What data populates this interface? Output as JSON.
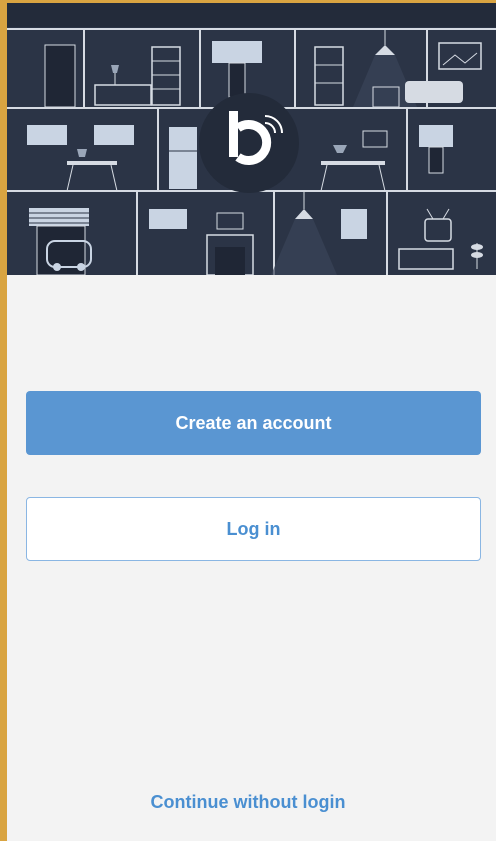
{
  "actions": {
    "create_account_label": "Create an account",
    "login_label": "Log in",
    "continue_label": "Continue without login"
  },
  "hero": {
    "logo_icon": "brand-logo-icon"
  },
  "colors": {
    "primary": "#5a96d2",
    "link": "#4a8fd1",
    "hero_background": "#2b3446",
    "page_background": "#f3f3f3"
  }
}
